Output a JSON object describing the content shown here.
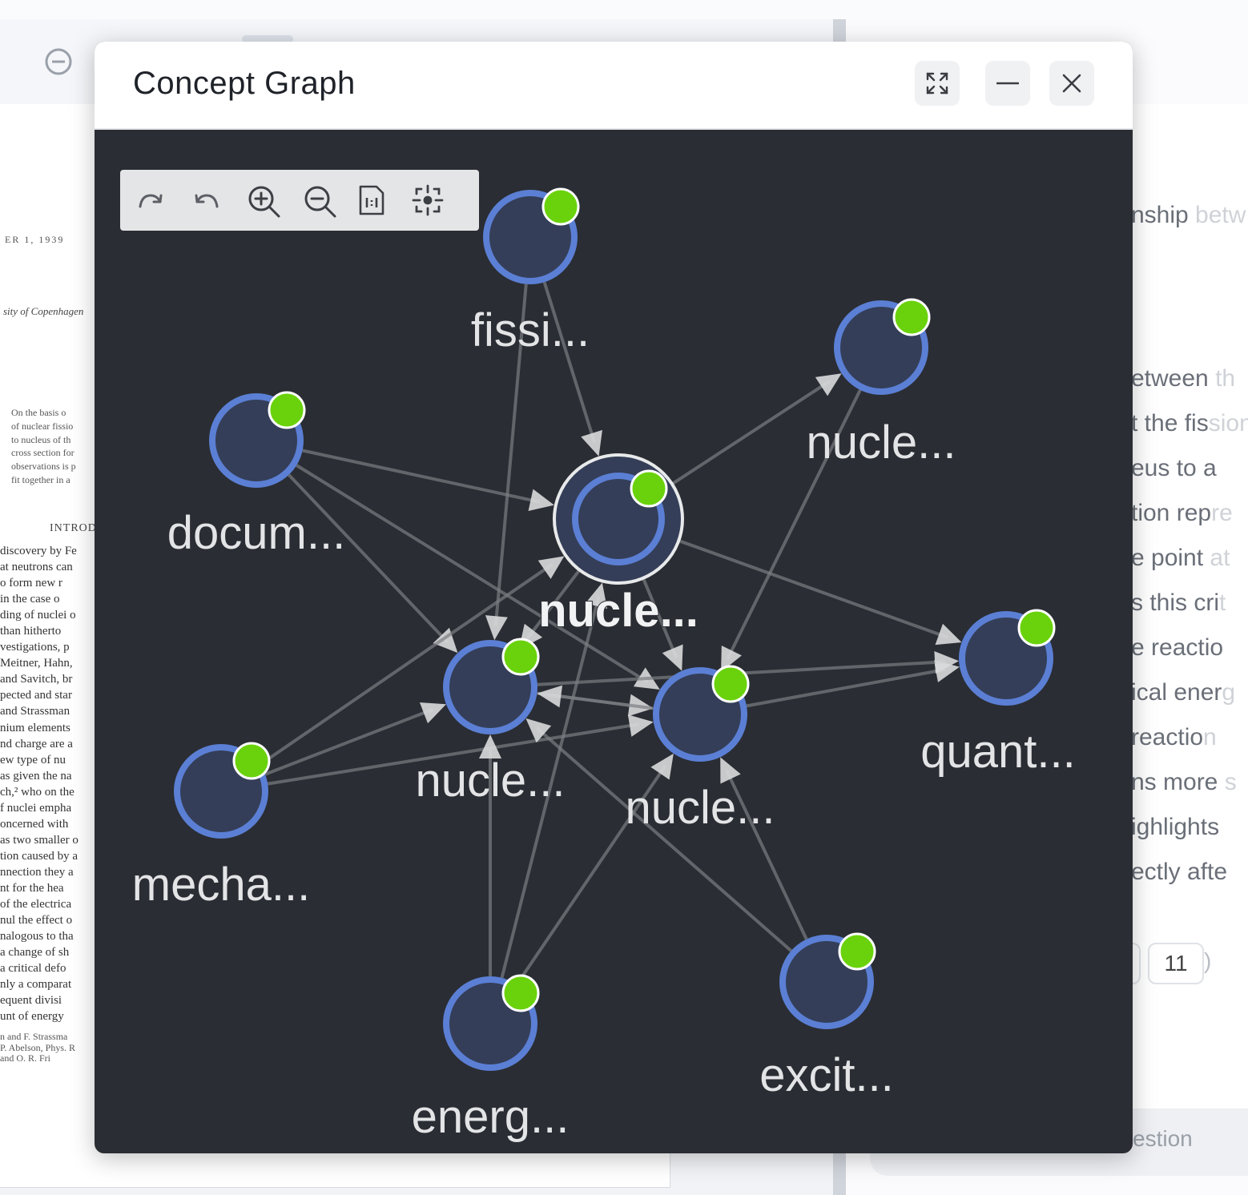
{
  "background": {
    "paper": {
      "header": "ER 1, 1939",
      "affiliation": "sity of Copenhagen",
      "abstract_lines": [
        "On the basis o",
        "of nuclear fissio",
        "to nucleus of th",
        "cross section for",
        "observations is p",
        "fit together in a"
      ],
      "section_heading": "INTROD",
      "body_lines": [
        "discovery by Fe",
        "at neutrons can",
        "o form new r",
        "in the case o",
        "ding of nuclei o",
        "than hitherto",
        "vestigations, p",
        "Meitner, Hahn,",
        "and Savitch, br",
        "pected and star",
        "and Strassman",
        "nium elements",
        "nd charge are a",
        "ew type of nu",
        "as given the na",
        "ch,² who on the",
        "f nuclei empha",
        "oncerned with",
        "as two smaller o",
        "tion caused by a",
        "nnection they a",
        "nt for the hea",
        "of the electrica",
        "nul the effect o",
        "nalogous to tha",
        "a change of sh",
        "a critical defo",
        "nly a comparat",
        "equent divisi",
        "unt of energy"
      ],
      "ref_lines": [
        "n and F. Strassma",
        "P. Abelson, Phys. R",
        "and O. R. Fri"
      ]
    },
    "right_panel": {
      "fragments": [
        {
          "text": "nship",
          "faded": " betw"
        },
        {
          "text": "etween",
          "faded": " th"
        },
        {
          "text": "t the fis",
          "faded": "sion"
        },
        {
          "text": "eus to a",
          "faded": ""
        },
        {
          "text": "tion rep",
          "faded": "re"
        },
        {
          "text": "e point",
          "faded": " at"
        },
        {
          "text": "s this cri",
          "faded": "t"
        },
        {
          "text": "e reactio",
          "faded": ""
        },
        {
          "text": "ical ener",
          "faded": "g"
        },
        {
          "text": "reactio",
          "faded": "n"
        },
        {
          "text": "ns more",
          "faded": " s"
        },
        {
          "text": "ighlights",
          "faded": ""
        },
        {
          "text": "ectly afte",
          "faded": ""
        }
      ],
      "page_number": "11",
      "question_text": "estion"
    }
  },
  "modal": {
    "title": "Concept Graph",
    "buttons": {
      "expand": "expand-icon",
      "minimize": "minimize-icon",
      "close": "close-icon"
    }
  },
  "toolbar": {
    "tools": [
      "redo-icon",
      "undo-icon",
      "zoom-in-icon",
      "zoom-out-icon",
      "fit-page-icon",
      "center-focus-icon"
    ]
  },
  "graph": {
    "colors": {
      "node_fill": "#343e58",
      "node_ring": "#5b7fd4",
      "badge": "#6ad20c",
      "edge": "#7a7d82",
      "arrow": "#d9dadc",
      "label": "#e3e4e6"
    },
    "nodes": [
      {
        "id": "fission",
        "label": "fissi...",
        "selected": false
      },
      {
        "id": "nucleus-top-right",
        "label": "nucle...",
        "selected": false
      },
      {
        "id": "document",
        "label": "docum...",
        "selected": false
      },
      {
        "id": "nucleus-center",
        "label": "nucle...",
        "selected": true
      },
      {
        "id": "nucleus-left",
        "label": "nucle...",
        "selected": false
      },
      {
        "id": "nucleus-right",
        "label": "nucle...",
        "selected": false
      },
      {
        "id": "quantum",
        "label": "quant...",
        "selected": false
      },
      {
        "id": "mechanism",
        "label": "mecha...",
        "selected": false
      },
      {
        "id": "energy",
        "label": "energ...",
        "selected": false
      },
      {
        "id": "excitation",
        "label": "excit...",
        "selected": false
      }
    ],
    "edges": [
      {
        "from": "fission",
        "to": "nucleus-center"
      },
      {
        "from": "fission",
        "to": "nucleus-left"
      },
      {
        "from": "document",
        "to": "nucleus-center"
      },
      {
        "from": "document",
        "to": "nucleus-left"
      },
      {
        "from": "document",
        "to": "nucleus-right"
      },
      {
        "from": "nucleus-center",
        "to": "nucleus-top-right"
      },
      {
        "from": "nucleus-center",
        "to": "quantum"
      },
      {
        "from": "nucleus-center",
        "to": "nucleus-left"
      },
      {
        "from": "nucleus-center",
        "to": "nucleus-right"
      },
      {
        "from": "nucleus-top-right",
        "to": "nucleus-right"
      },
      {
        "from": "nucleus-left",
        "to": "nucleus-right"
      },
      {
        "from": "nucleus-right",
        "to": "nucleus-left"
      },
      {
        "from": "nucleus-right",
        "to": "quantum"
      },
      {
        "from": "nucleus-left",
        "to": "quantum"
      },
      {
        "from": "mechanism",
        "to": "nucleus-center"
      },
      {
        "from": "mechanism",
        "to": "nucleus-left"
      },
      {
        "from": "mechanism",
        "to": "nucleus-right"
      },
      {
        "from": "energy",
        "to": "nucleus-left"
      },
      {
        "from": "energy",
        "to": "nucleus-right"
      },
      {
        "from": "energy",
        "to": "nucleus-center"
      },
      {
        "from": "excitation",
        "to": "nucleus-left"
      },
      {
        "from": "excitation",
        "to": "nucleus-right"
      }
    ]
  }
}
